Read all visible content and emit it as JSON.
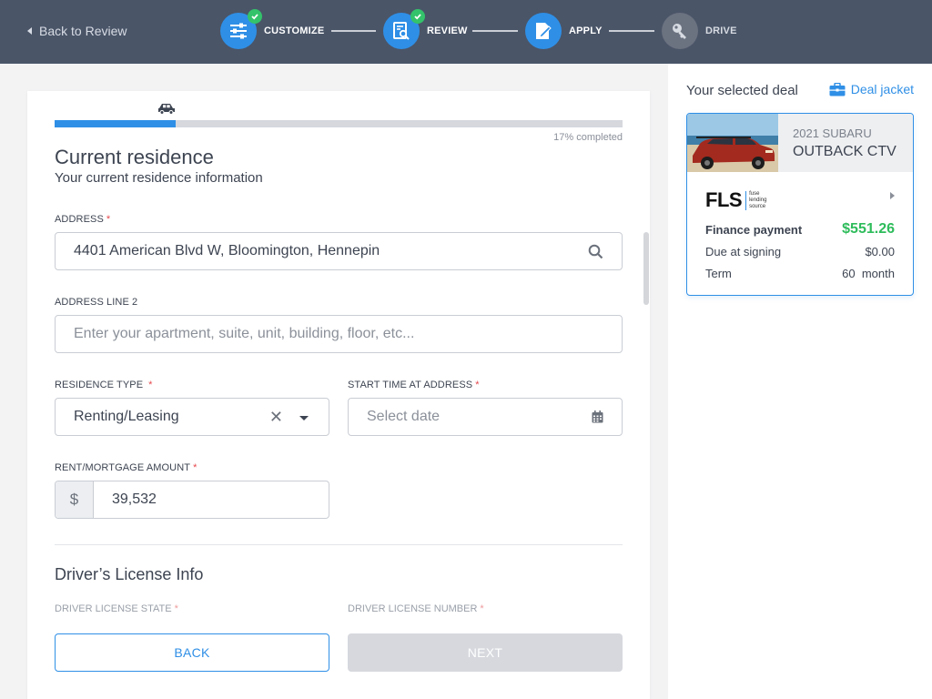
{
  "header": {
    "back_label": "Back to Review",
    "steps": [
      {
        "label": "CUSTOMIZE",
        "done": true
      },
      {
        "label": "REVIEW",
        "done": true
      },
      {
        "label": "APPLY",
        "done": false
      },
      {
        "label": "DRIVE",
        "done": false
      }
    ]
  },
  "form": {
    "progress_percent": 17,
    "progress_text": "17% completed",
    "title": "Current residence",
    "subtitle": "Your current residence information",
    "address": {
      "label": "ADDRESS",
      "value": "4401 American Blvd W, Bloomington, Hennepin"
    },
    "address2": {
      "label": "ADDRESS LINE 2",
      "placeholder": "Enter your apartment, suite, unit, building, floor, etc..."
    },
    "residence_type": {
      "label": "RESIDENCE TYPE",
      "value": "Renting/Leasing"
    },
    "start_time": {
      "label": "START TIME AT ADDRESS",
      "placeholder": "Select date"
    },
    "rent": {
      "label": "RENT/MORTGAGE AMOUNT",
      "currency": "$",
      "value": "39,532"
    },
    "license_title": "Driver’s License Info",
    "license_state_label": "DRIVER LICENSE STATE",
    "license_number_label": "DRIVER LICENSE NUMBER",
    "back_button": "BACK",
    "next_button": "NEXT"
  },
  "deal": {
    "title": "Your selected deal",
    "jacket_label": "Deal jacket",
    "car_year": "2021 SUBARU",
    "car_model": "OUTBACK CTV",
    "lender_logo": "FLS",
    "lender_sub": [
      "fuse",
      "lending",
      "source"
    ],
    "finance_label": "Finance payment",
    "finance_value": "$551.26",
    "due_label": "Due at signing",
    "due_value": "$0.00",
    "term_label": "Term",
    "term_value": "60  month"
  },
  "colors": {
    "accent": "#2f8fe6",
    "success": "#2ebc5b",
    "header_bg": "#4a5568",
    "required": "#e5484d"
  }
}
